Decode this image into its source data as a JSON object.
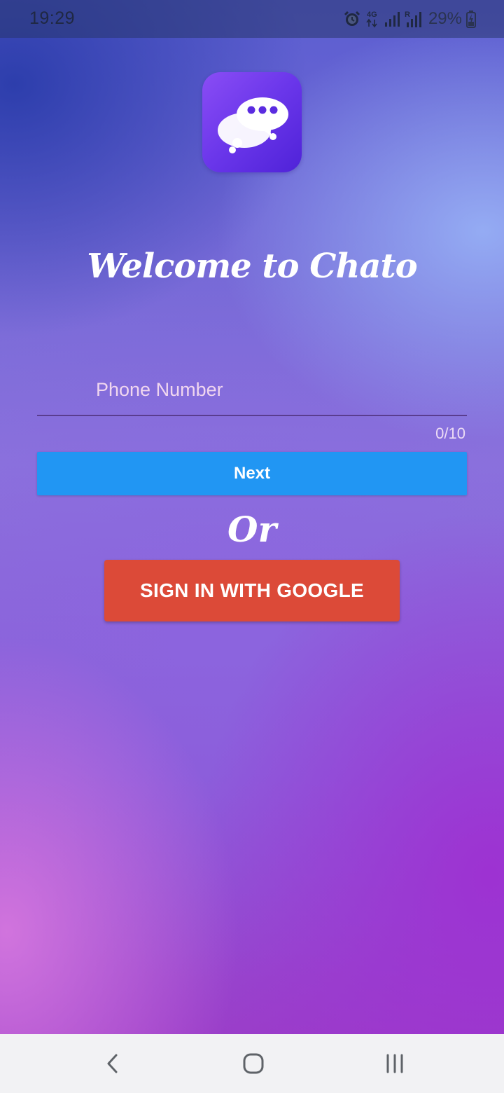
{
  "status_bar": {
    "time": "19:29",
    "network_type": "4G",
    "roaming_indicator": "R",
    "battery": "29%",
    "icons": [
      "alarm-icon",
      "network-4g-icon",
      "signal-icon",
      "signal-roaming-icon",
      "battery-charging-icon"
    ]
  },
  "app": {
    "logo_icon": "chat-bubbles-icon",
    "welcome": "Welcome to Chato"
  },
  "login": {
    "phone_placeholder": "Phone Number",
    "phone_value": "",
    "counter": "0/10",
    "next_label": "Next",
    "or_label": "Or",
    "google_label": "SIGN IN WITH GOOGLE"
  },
  "colors": {
    "next_button": "#2196f3",
    "google_button": "#dc4a38",
    "logo_gradient_start": "#8a4df5",
    "logo_gradient_end": "#4f22d8"
  },
  "nav_bar": {
    "buttons": [
      "back-icon",
      "home-icon",
      "recents-icon"
    ]
  }
}
